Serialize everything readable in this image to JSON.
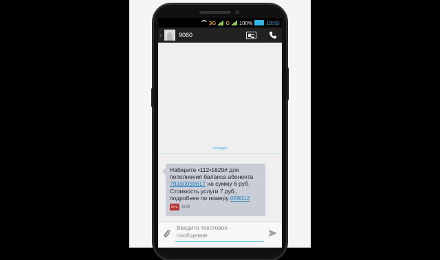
{
  "status_bar": {
    "network_3g": "3G",
    "network_g": "G",
    "battery_percent": "100%",
    "time": "19:03"
  },
  "header": {
    "contact_name": "9060",
    "contact_icon": "contact-card-icon",
    "call_icon": "phone-icon"
  },
  "conversation": {
    "date_label": "Сегодня",
    "message": {
      "line1": "Наберите •112•1629# для",
      "line2": "пополнения баланса абонента",
      "link1": "79160059617",
      "line3_rest": " на сумму 6 руб.",
      "line4": "Стоимость услуги 7 руб.,",
      "line5": "подробнее по номеру ",
      "link2": "059012",
      "sim_label": "МТС",
      "time": "19:02"
    }
  },
  "composer": {
    "placeholder_line1": "Введите текстовое",
    "placeholder_line2": "сообщение",
    "attach_icon": "paperclip-icon",
    "send_icon": "send-icon"
  },
  "colors": {
    "accent": "#33b5e5",
    "bubble": "#c9ced6",
    "action_bar": "#222222"
  }
}
